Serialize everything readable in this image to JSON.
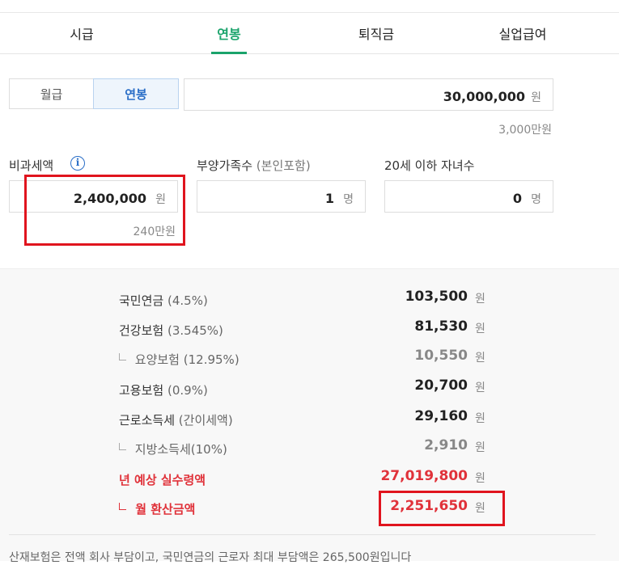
{
  "tabs": [
    {
      "label": "시급"
    },
    {
      "label": "연봉"
    },
    {
      "label": "퇴직금"
    },
    {
      "label": "실업급여"
    }
  ],
  "active_tab": "연봉",
  "pay_type": {
    "monthly": "월급",
    "annual": "연봉",
    "selected": "연봉"
  },
  "salary": {
    "value": "30,000,000",
    "unit": "원",
    "korean": "3,000만원"
  },
  "nontaxable": {
    "label": "비과세액",
    "value": "2,400,000",
    "unit": "원",
    "korean": "240만원",
    "info_icon": "info-icon"
  },
  "dependents": {
    "label": "부양가족수",
    "label_note": "(본인포함)",
    "value": "1",
    "unit": "명"
  },
  "children": {
    "label": "20세 이하 자녀수",
    "value": "0",
    "unit": "명"
  },
  "results": [
    {
      "label": "국민연금",
      "note": "(4.5%)",
      "value": "103,500",
      "unit": "원"
    },
    {
      "label": "건강보험",
      "note": "(3.545%)",
      "value": "81,530",
      "unit": "원"
    },
    {
      "label": "요양보험",
      "note": "(12.95%)",
      "value": "10,550",
      "unit": "원"
    },
    {
      "label": "고용보험",
      "note": "(0.9%)",
      "value": "20,700",
      "unit": "원"
    },
    {
      "label": "근로소득세",
      "note": "(간이세액)",
      "value": "29,160",
      "unit": "원"
    },
    {
      "label": "지방소득세(10%)",
      "note": "",
      "value": "2,910",
      "unit": "원"
    },
    {
      "label": "년 예상 실수령액",
      "note": "",
      "value": "27,019,800",
      "unit": "원"
    },
    {
      "label": "월 환산금액",
      "note": "",
      "value": "2,251,650",
      "unit": "원"
    }
  ],
  "footnote": "산재보험은 전액 회사 부담이고, 국민연금의 근로자 최대 부담액은 265,500원입니다",
  "colors": {
    "accent_green": "#1aa36b",
    "accent_blue": "#2a6ec7",
    "highlight_red": "#e0323a",
    "frame_red": "#e0141e"
  }
}
